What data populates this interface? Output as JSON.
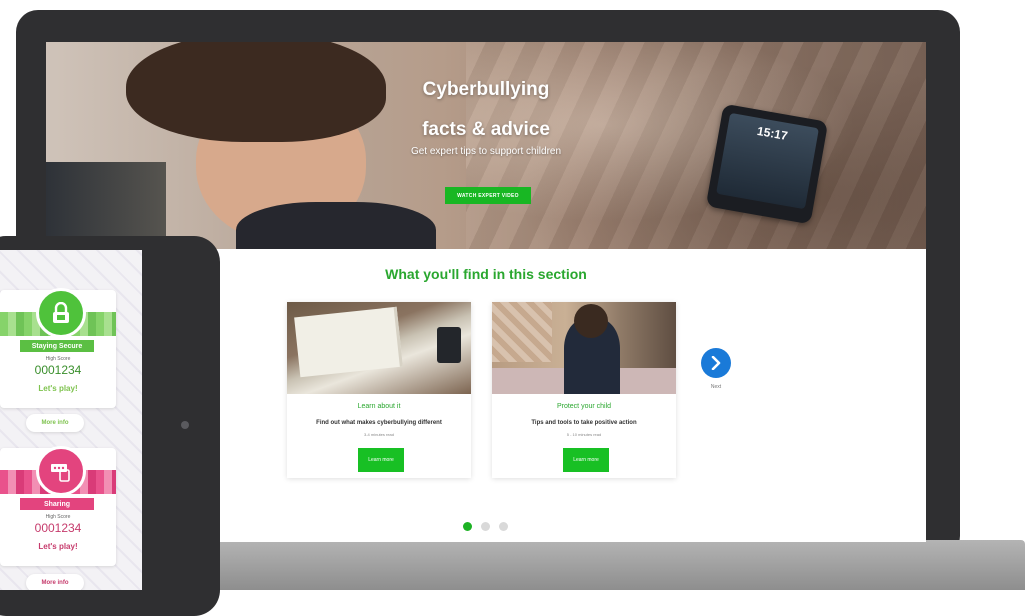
{
  "hero": {
    "title_line1": "Cyberbullying",
    "title_line2": "facts & advice",
    "subtitle": "Get expert tips to support children",
    "button_label": "WATCH EXPERT VIDEO",
    "phone_time": "15:17"
  },
  "section": {
    "title": "What you'll find in this section",
    "cards": [
      {
        "title": "Learn about it",
        "description": "Find out what makes cyberbullying different",
        "meta": "3-4 minutes read",
        "button": "Learn more"
      },
      {
        "title": "Protect your child",
        "description": "Tips and tools to take positive action",
        "meta": "5 - 10 minutes read",
        "button": "Learn more"
      }
    ],
    "next_label": "Next",
    "page_dots": 3,
    "active_dot": 1
  },
  "tablet": {
    "games": [
      {
        "name": "Staying Secure",
        "high_score_label": "High Score",
        "high_score": "0001234",
        "play": "Let's play!",
        "more_info": "More info",
        "icon": "padlock-icon",
        "color": "#5bbf43"
      },
      {
        "name": "Sharing",
        "high_score_label": "High Score",
        "high_score": "0001234",
        "play": "Let's play!",
        "more_info": "More info",
        "icon": "password-phone-icon",
        "color": "#e3447e"
      }
    ]
  },
  "colors": {
    "brand_green": "#18b723",
    "next_blue": "#1a7ad8",
    "device_frame": "#2f2f31"
  }
}
